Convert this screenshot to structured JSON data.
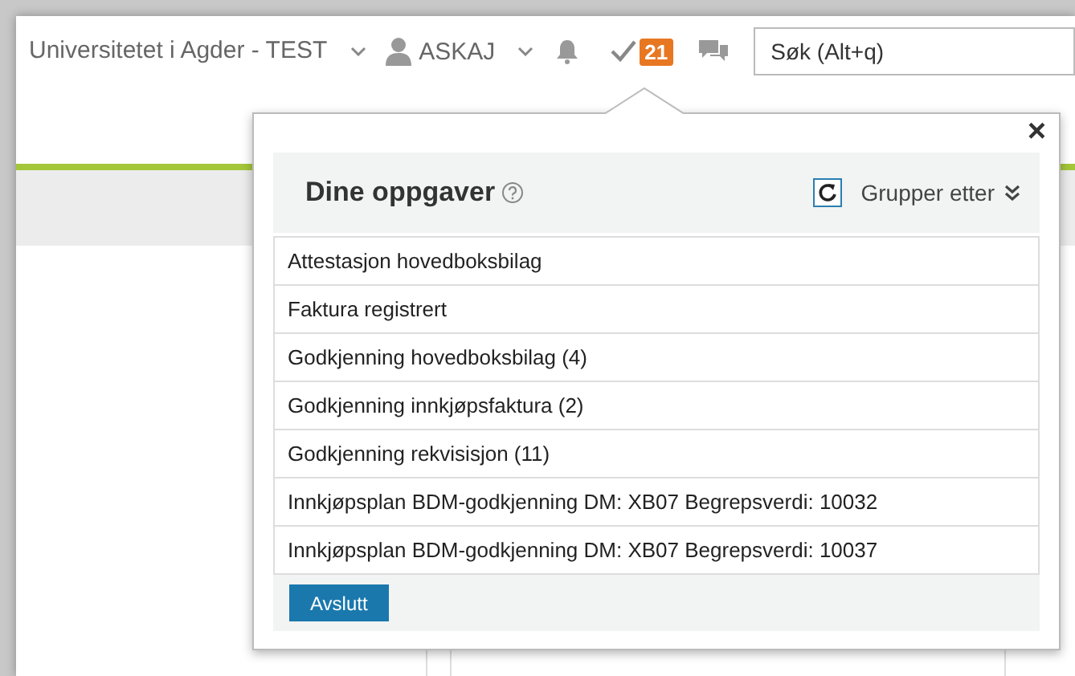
{
  "header": {
    "organization": "Universitetet i Agder - TEST",
    "user": "ASKAJ",
    "task_count": "21",
    "search": {
      "placeholder": "Søk (Alt+q)"
    }
  },
  "tasks_popup": {
    "title": "Dine oppgaver",
    "group_by": "Grupper etter",
    "close": "×",
    "items": [
      {
        "label": "Attestasjon hovedboksbilag"
      },
      {
        "label": "Faktura registrert"
      },
      {
        "label": "Godkjenning hovedboksbilag (4)"
      },
      {
        "label": "Godkjenning innkjøpsfaktura (2)"
      },
      {
        "label": "Godkjenning rekvisisjon (11)"
      },
      {
        "label": "Innkjøpsplan BDM-godkjenning DM: XB07 Begrepsverdi: 10032"
      },
      {
        "label": "Innkjøpsplan BDM-godkjenning DM: XB07 Begrepsverdi: 10037"
      }
    ],
    "finish_button": "Avslutt"
  }
}
